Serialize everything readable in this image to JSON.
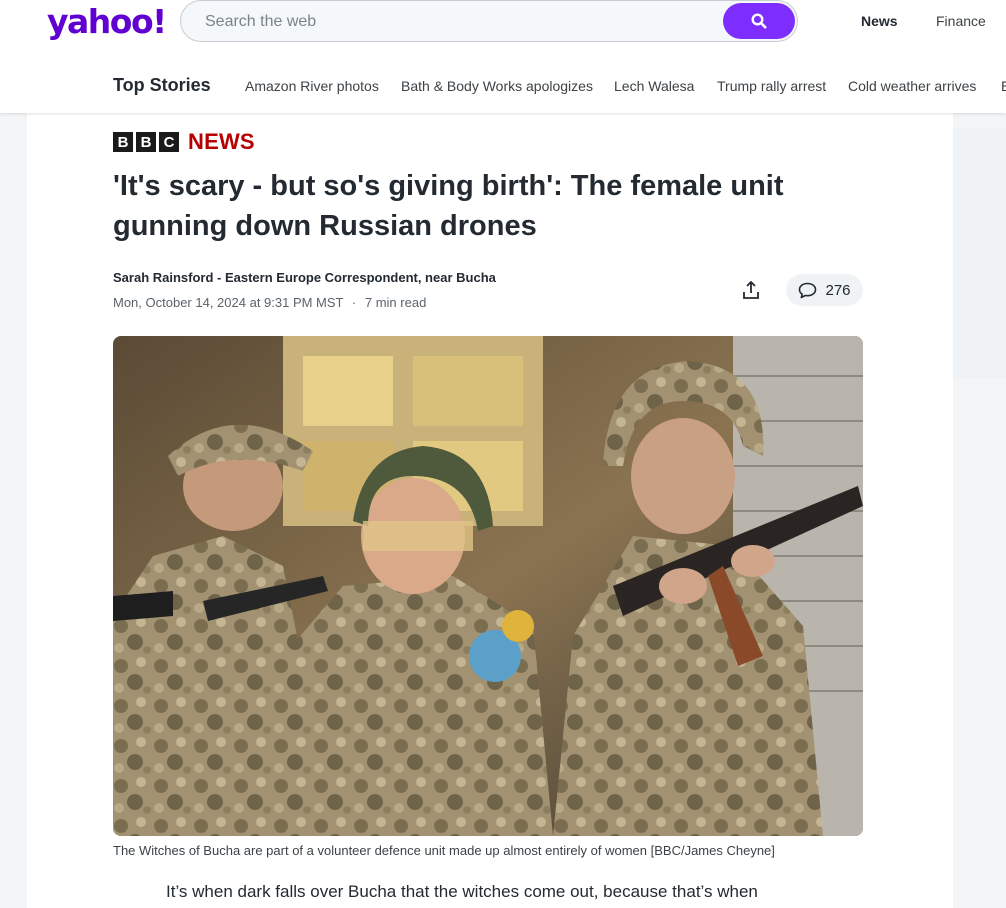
{
  "header": {
    "logo": "yahoo!",
    "search_placeholder": "Search the web",
    "nav": [
      "News",
      "Finance"
    ]
  },
  "topstories": {
    "label": "Top Stories",
    "items": [
      "Amazon River photos",
      "Bath & Body Works apologizes",
      "Lech Walesa",
      "Trump rally arrest",
      "Cold weather arrives",
      "E"
    ]
  },
  "article": {
    "source_letters": [
      "B",
      "B",
      "C"
    ],
    "source_news": "NEWS",
    "headline": "'It's scary - but so's giving birth': The female unit gunning down Russian drones",
    "byline": "Sarah Rainsford - Eastern Europe Correspondent, near Bucha",
    "date": "Mon, October 14, 2024 at 9:31 PM MST",
    "separator": "·",
    "read_time": "7 min read",
    "comment_count": "276",
    "caption": "The Witches of Bucha are part of a volunteer defence unit made up almost entirely of women [BBC/James Cheyne]",
    "first_line": "It’s when dark falls over Bucha that the witches come out, because that’s when"
  },
  "colors": {
    "brand": "#6001d2",
    "search_button": "#7d2eff",
    "bbc_red": "#b80000"
  }
}
